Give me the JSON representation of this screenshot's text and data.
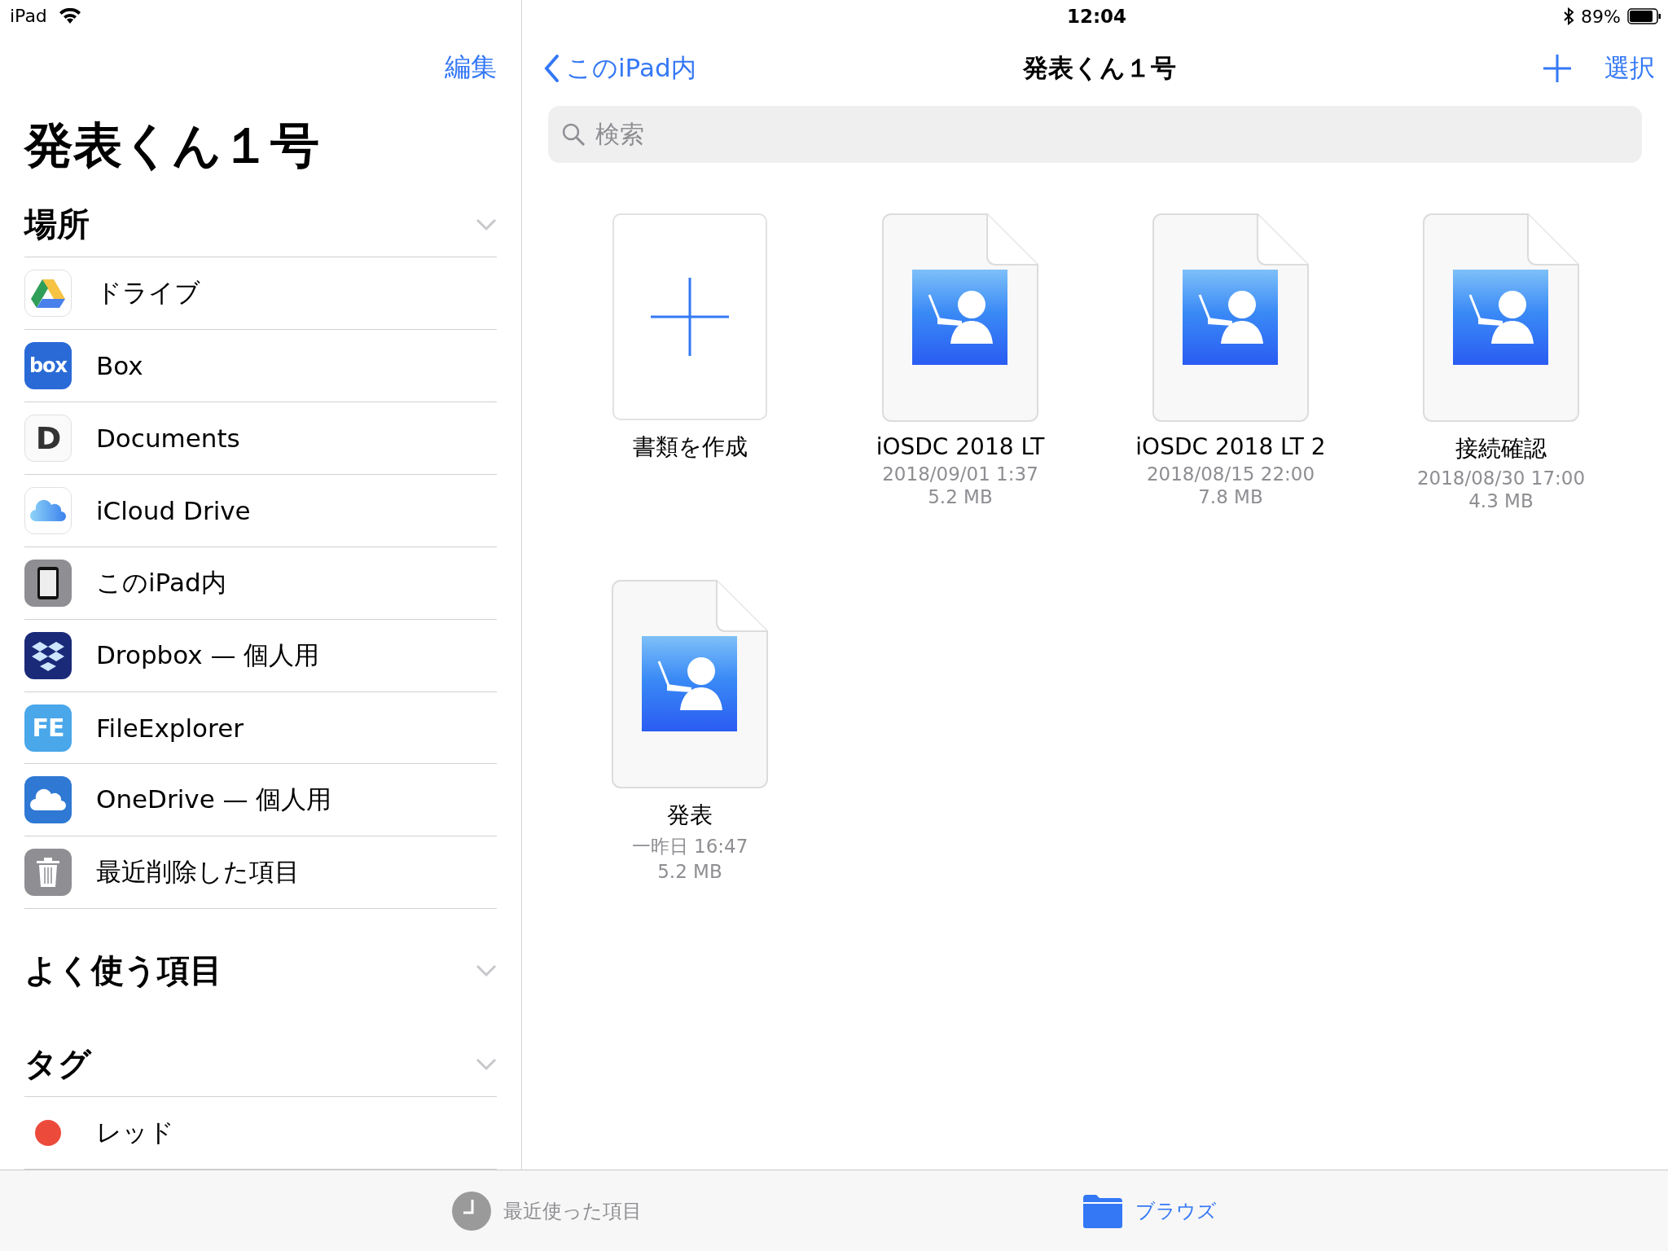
{
  "status_bar": {
    "device": "iPad",
    "time": "12:04",
    "battery": "89%"
  },
  "sidebar": {
    "edit": "編集",
    "title": "発表くん１号",
    "sections": [
      {
        "title": "場所",
        "expanded": true,
        "items": [
          {
            "kind": "gdrive",
            "label": "ドライブ"
          },
          {
            "kind": "box",
            "label": "Box",
            "logo_text": "box"
          },
          {
            "kind": "documents",
            "label": "Documents",
            "logo_text": "D"
          },
          {
            "kind": "icloud",
            "label": "iCloud Drive"
          },
          {
            "kind": "ipad",
            "label": "このiPad内"
          },
          {
            "kind": "dropbox",
            "label": "Dropbox — 個人用"
          },
          {
            "kind": "fileexplorer",
            "label": "FileExplorer",
            "logo_text": "FE"
          },
          {
            "kind": "onedrive",
            "label": "OneDrive — 個人用"
          },
          {
            "kind": "trash",
            "label": "最近削除した項目"
          }
        ]
      },
      {
        "title": "よく使う項目",
        "expanded": true
      },
      {
        "title": "タグ",
        "expanded": true,
        "items": [
          {
            "kind": "tag",
            "label": "レッド",
            "color": "#ec4b3c"
          }
        ]
      }
    ]
  },
  "nav": {
    "back": "このiPad内",
    "title": "発表くん１号",
    "select": "選択"
  },
  "search": {
    "placeholder": "検索"
  },
  "files": [
    {
      "kind": "new",
      "name": "書類を作成"
    },
    {
      "kind": "keynote",
      "name": "iOSDC 2018 LT",
      "date": "2018/09/01 1:37",
      "size": "5.2 MB"
    },
    {
      "kind": "keynote",
      "name": "iOSDC 2018 LT 2",
      "date": "2018/08/15 22:00",
      "size": "7.8 MB"
    },
    {
      "kind": "keynote",
      "name": "接続確認",
      "date": "2018/08/30 17:00",
      "size": "4.3 MB"
    },
    {
      "kind": "keynote",
      "name": "発表",
      "date": "一昨日 16:47",
      "size": "5.2 MB"
    }
  ],
  "tab_bar": [
    {
      "kind": "recents",
      "label": "最近使った項目",
      "selected": false
    },
    {
      "kind": "browse",
      "label": "ブラウズ",
      "selected": true
    }
  ]
}
